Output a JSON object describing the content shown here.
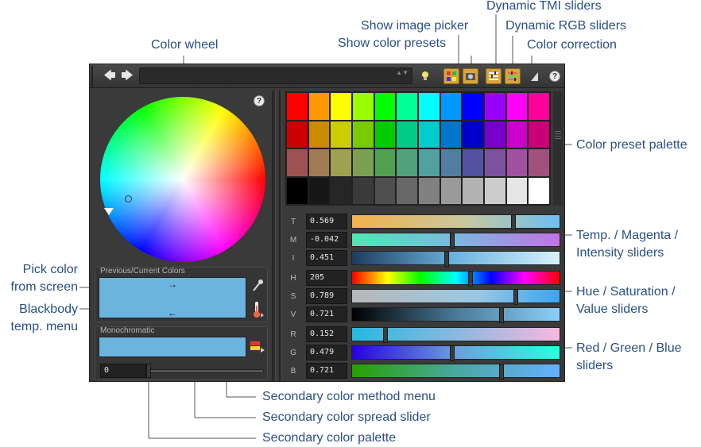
{
  "callouts": {
    "color_wheel": "Color wheel",
    "show_image_picker": "Show image picker",
    "show_color_presets": "Show color presets",
    "dynamic_tmi": "Dynamic TMI sliders",
    "dynamic_rgb": "Dynamic RGB sliders",
    "color_correction": "Color correction",
    "preset_palette": "Color preset palette",
    "tmi_line1": "Temp. / Magenta /",
    "tmi_line2": "Intensity sliders",
    "hsv_line1": "Hue / Saturation /",
    "hsv_line2": "Value sliders",
    "rgb_line1": "Red / Green / Blue",
    "rgb_line2": "sliders",
    "pick_line1": "Pick color",
    "pick_line2": "from screen",
    "bb_line1": "Blackbody",
    "bb_line2": "temp. menu",
    "sec_method": "Secondary color method menu",
    "sec_spread": "Secondary color spread slider",
    "sec_palette": "Secondary color palette"
  },
  "panel": {
    "help_glyph": "?",
    "wheel_help_glyph": "?",
    "prev_current_title": "Previous/Current Colors",
    "prev_arrow": "→",
    "current_arrow": "←",
    "mono_title": "Monochromatic",
    "mono_value": "0",
    "current_color": "#6cb4e0",
    "accent_on": "#d9a43a"
  },
  "toolbar": {
    "back_glyph": "🡄",
    "forward_glyph": "🡆",
    "spin_glyph": "▲▼"
  },
  "presets": [
    [
      "#ff0000",
      "#ff9900",
      "#ffff00",
      "#99ff00",
      "#00ff00",
      "#00ff99",
      "#00ffff",
      "#0099ff",
      "#0000ff",
      "#9900ff",
      "#ff00ff",
      "#ff0099"
    ],
    [
      "#cc0000",
      "#cc8a00",
      "#cccc00",
      "#77cc00",
      "#00cc00",
      "#00cc88",
      "#00cccc",
      "#0077cc",
      "#0000cc",
      "#7700cc",
      "#cc00cc",
      "#cc0077"
    ],
    [
      "#a05252",
      "#a07c52",
      "#a0a052",
      "#7ca052",
      "#52a052",
      "#52a07c",
      "#52a0a0",
      "#527ca0",
      "#5252a0",
      "#7c52a0",
      "#a052a0",
      "#a0527c"
    ],
    [
      "#000000",
      "#171717",
      "#262626",
      "#3a3a3a",
      "#4f4f4f",
      "#676767",
      "#808080",
      "#9a9a9a",
      "#b3b3b3",
      "#cccccc",
      "#e6e6e6",
      "#ffffff"
    ]
  ],
  "sliders": {
    "tmi": [
      {
        "label": "T",
        "value": "0.569",
        "level": 0.78
      },
      {
        "label": "M",
        "value": "-0.042",
        "level": 0.48
      },
      {
        "label": "I",
        "value": "0.451",
        "level": 0.45
      }
    ],
    "hsv": [
      {
        "label": "H",
        "value": "205",
        "level": 0.57
      },
      {
        "label": "S",
        "value": "0.789",
        "level": 0.79
      },
      {
        "label": "V",
        "value": "0.721",
        "level": 0.72
      }
    ],
    "rgb": [
      {
        "label": "R",
        "value": "0.152",
        "level": 0.15
      },
      {
        "label": "G",
        "value": "0.479",
        "level": 0.48
      },
      {
        "label": "B",
        "value": "0.721",
        "level": 0.72
      }
    ]
  },
  "icons": {
    "picker": "eyedropper-icon",
    "blackbody": "thermometer-icon",
    "method_menu": "color-method-icon"
  }
}
